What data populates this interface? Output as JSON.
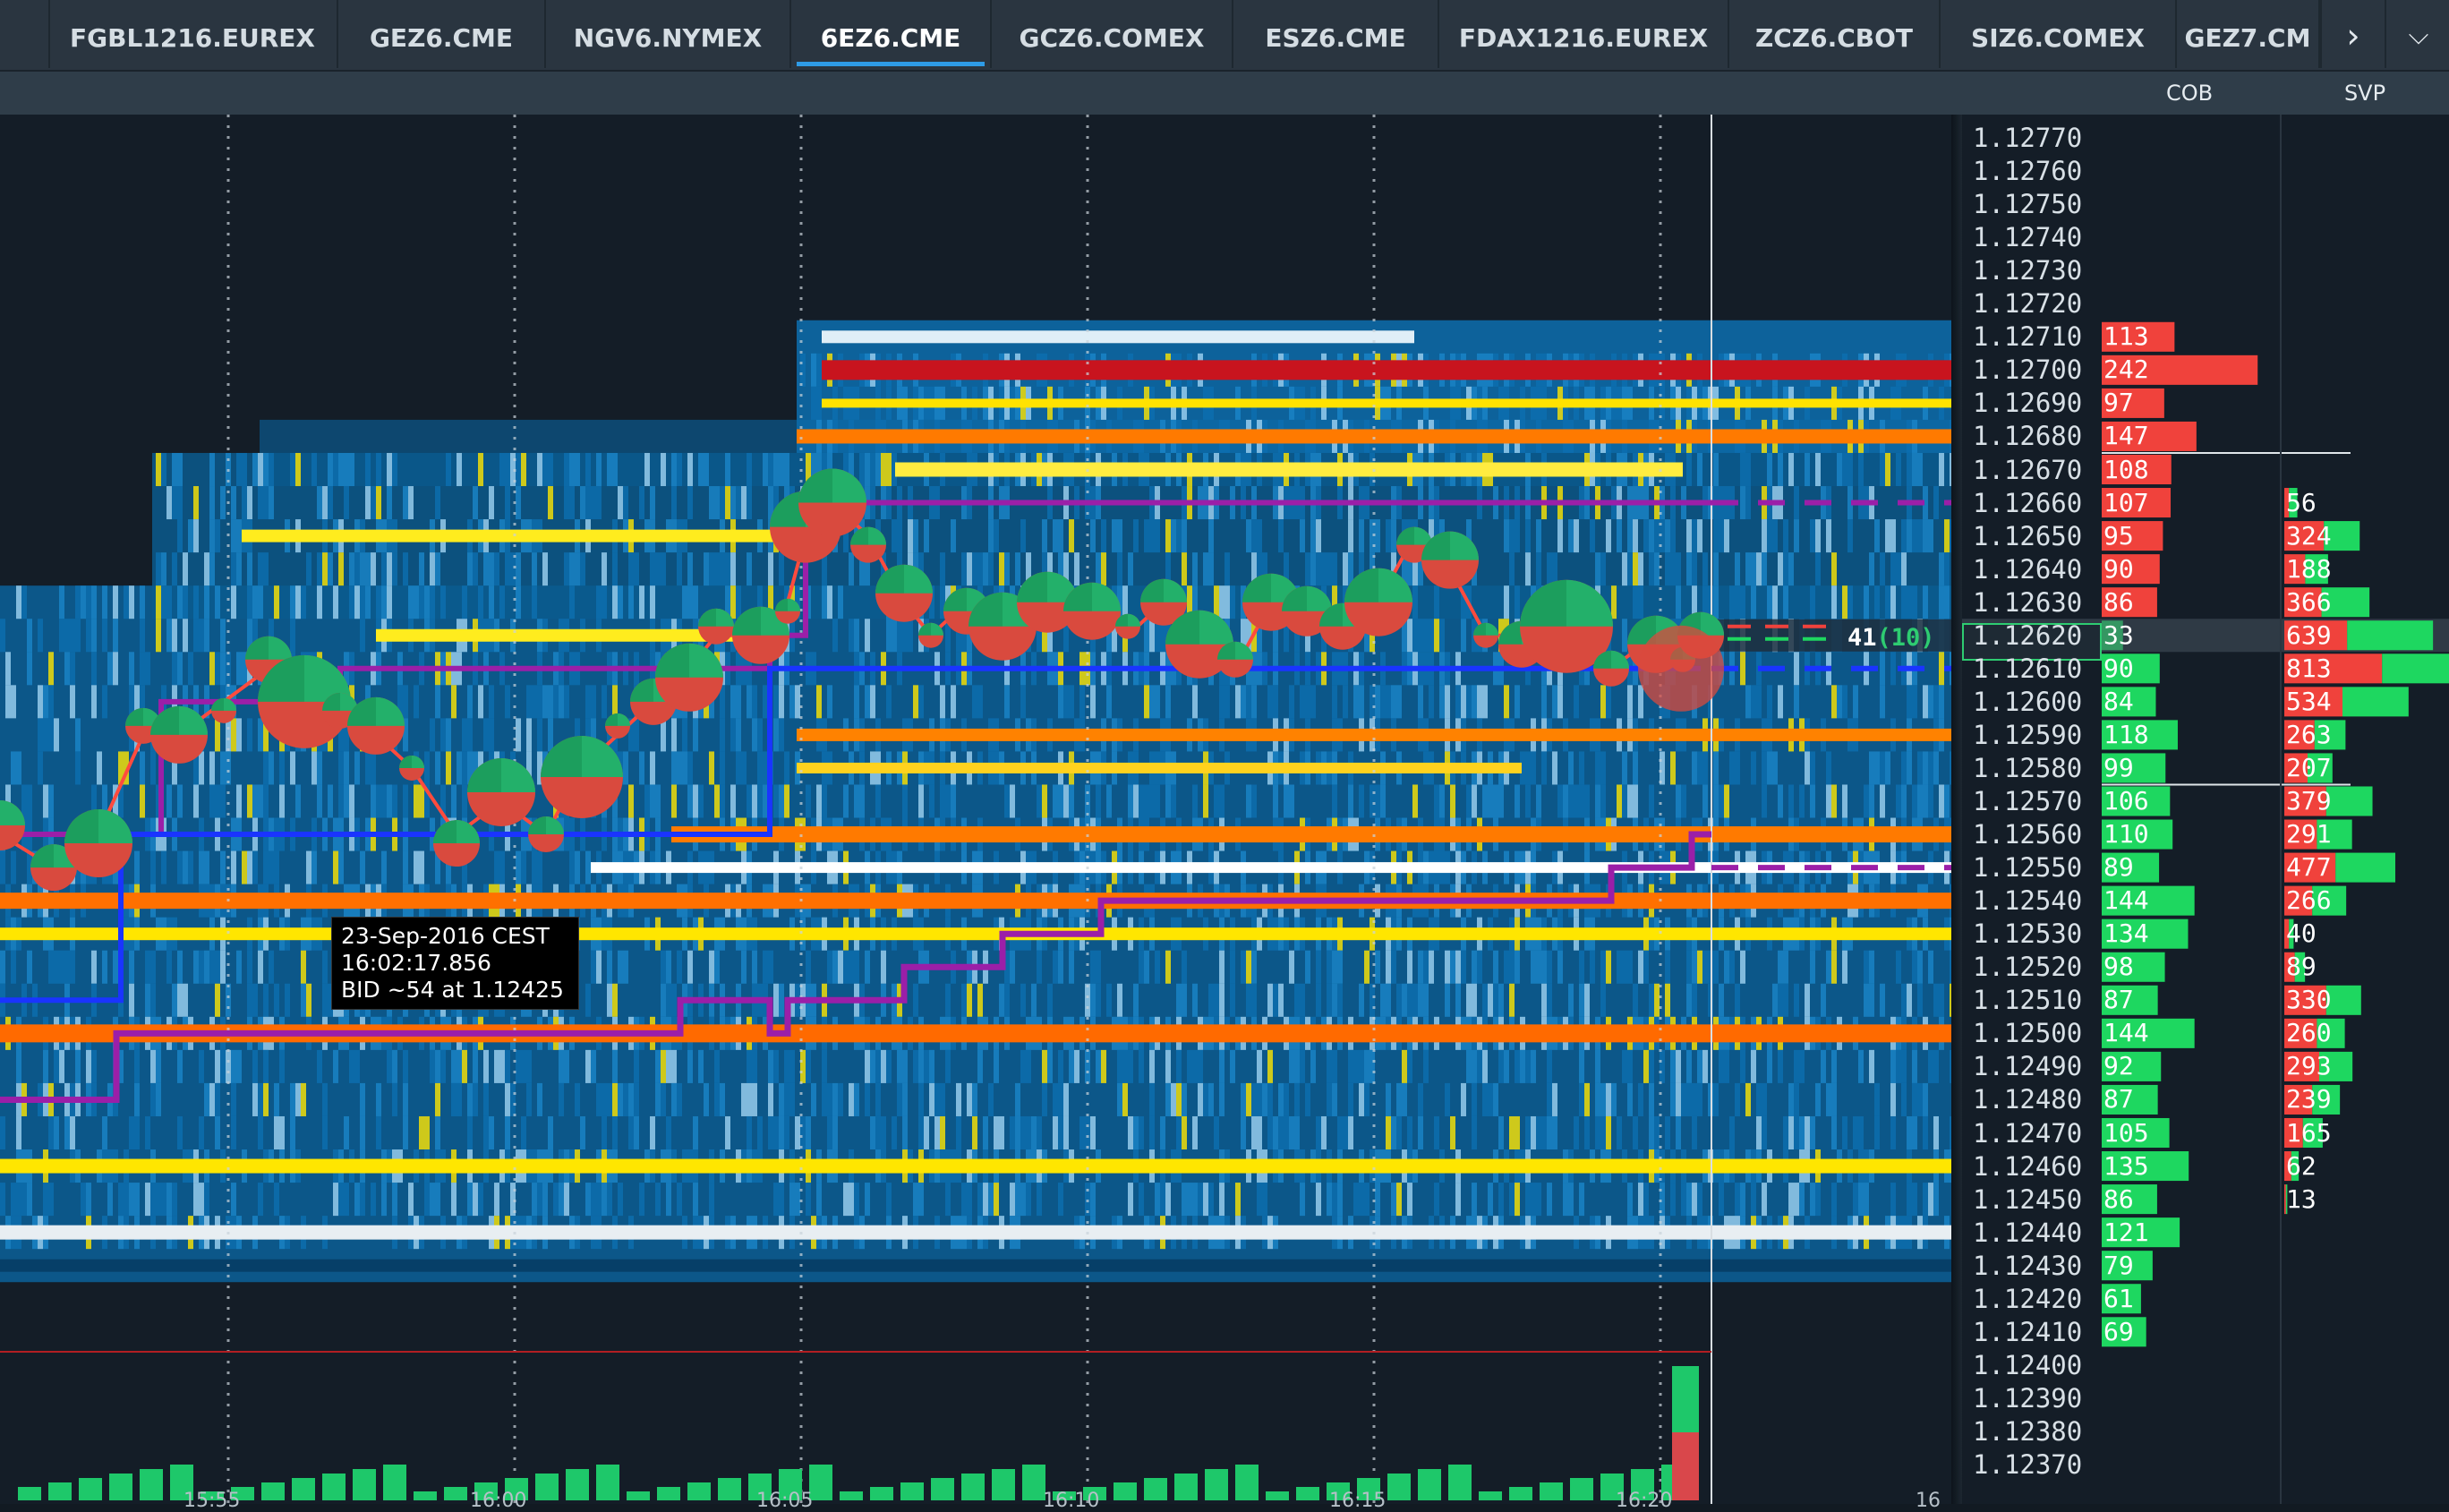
{
  "tabs": [
    {
      "label": "FGBL1216.EUREX",
      "active": false
    },
    {
      "label": "GEZ6.CME",
      "active": false
    },
    {
      "label": "NGV6.NYMEX",
      "active": false
    },
    {
      "label": "6EZ6.CME",
      "active": true
    },
    {
      "label": "GCZ6.COMEX",
      "active": false
    },
    {
      "label": "ESZ6.CME",
      "active": false
    },
    {
      "label": "FDAX1216.EUREX",
      "active": false
    },
    {
      "label": "ZCZ6.CBOT",
      "active": false
    },
    {
      "label": "SIZ6.COMEX",
      "active": false
    },
    {
      "label": "GEZ7.CM",
      "active": false
    }
  ],
  "tab_next_icon": "chevron-right-icon",
  "tab_menu_icon": "chevron-down-icon",
  "columns": {
    "cob": "COB",
    "svp": "SVP"
  },
  "tooltip": {
    "line1": "23-Sep-2016 CEST",
    "line2": "16:02:17.856",
    "line3": "BID ~54 at 1.12425"
  },
  "current": {
    "size": "41",
    "count": "(10)"
  },
  "price_levels": [
    "1.12770",
    "1.12760",
    "1.12750",
    "1.12740",
    "1.12730",
    "1.12720",
    "1.12710",
    "1.12700",
    "1.12690",
    "1.12680",
    "1.12670",
    "1.12660",
    "1.12650",
    "1.12640",
    "1.12630",
    "1.12620",
    "1.12610",
    "1.12600",
    "1.12590",
    "1.12580",
    "1.12570",
    "1.12560",
    "1.12550",
    "1.12540",
    "1.12530",
    "1.12520",
    "1.12510",
    "1.12500",
    "1.12490",
    "1.12480",
    "1.12470",
    "1.12460",
    "1.12450",
    "1.12440",
    "1.12430",
    "1.12420",
    "1.12410",
    "1.12400",
    "1.12390",
    "1.12380",
    "1.12370"
  ],
  "cob": {
    "asks": [
      {
        "price": "1.12710",
        "size": "113",
        "value": 113
      },
      {
        "price": "1.12700",
        "size": "242",
        "value": 242
      },
      {
        "price": "1.12690",
        "size": "97",
        "value": 97
      },
      {
        "price": "1.12680",
        "size": "147",
        "value": 147
      },
      {
        "price": "1.12670",
        "size": "108",
        "value": 108
      },
      {
        "price": "1.12660",
        "size": "107",
        "value": 107
      },
      {
        "price": "1.12650",
        "size": "95",
        "value": 95
      },
      {
        "price": "1.12640",
        "size": "90",
        "value": 90
      },
      {
        "price": "1.12630",
        "size": "86",
        "value": 86
      }
    ],
    "bids": [
      {
        "price": "1.12620",
        "size": "33",
        "value": 33
      },
      {
        "price": "1.12610",
        "size": "90",
        "value": 90
      },
      {
        "price": "1.12600",
        "size": "84",
        "value": 84
      },
      {
        "price": "1.12590",
        "size": "118",
        "value": 118
      },
      {
        "price": "1.12580",
        "size": "99",
        "value": 99
      },
      {
        "price": "1.12570",
        "size": "106",
        "value": 106
      },
      {
        "price": "1.12560",
        "size": "110",
        "value": 110
      },
      {
        "price": "1.12550",
        "size": "89",
        "value": 89
      },
      {
        "price": "1.12540",
        "size": "144",
        "value": 144
      },
      {
        "price": "1.12530",
        "size": "134",
        "value": 134
      },
      {
        "price": "1.12520",
        "size": "98",
        "value": 98
      },
      {
        "price": "1.12510",
        "size": "87",
        "value": 87
      },
      {
        "price": "1.12500",
        "size": "144",
        "value": 144
      },
      {
        "price": "1.12490",
        "size": "92",
        "value": 92
      },
      {
        "price": "1.12480",
        "size": "87",
        "value": 87
      },
      {
        "price": "1.12470",
        "size": "105",
        "value": 105
      },
      {
        "price": "1.12460",
        "size": "135",
        "value": 135
      },
      {
        "price": "1.12450",
        "size": "86",
        "value": 86
      },
      {
        "price": "1.12440",
        "size": "121",
        "value": 121
      },
      {
        "price": "1.12430",
        "size": "79",
        "value": 79
      },
      {
        "price": "1.12420",
        "size": "61",
        "value": 61
      },
      {
        "price": "1.12410",
        "size": "69",
        "value": 69
      }
    ]
  },
  "svp": [
    {
      "price": "1.12660",
      "size": "56",
      "sell": 20,
      "buy": 36
    },
    {
      "price": "1.12650",
      "size": "324",
      "sell": 170,
      "buy": 154
    },
    {
      "price": "1.12640",
      "size": "188",
      "sell": 90,
      "buy": 98
    },
    {
      "price": "1.12630",
      "size": "366",
      "sell": 160,
      "buy": 206
    },
    {
      "price": "1.12620",
      "size": "639",
      "sell": 270,
      "buy": 369
    },
    {
      "price": "1.12610",
      "size": "813",
      "sell": 420,
      "buy": 393
    },
    {
      "price": "1.12600",
      "size": "534",
      "sell": 250,
      "buy": 284
    },
    {
      "price": "1.12590",
      "size": "263",
      "sell": 130,
      "buy": 133
    },
    {
      "price": "1.12580",
      "size": "207",
      "sell": 100,
      "buy": 107
    },
    {
      "price": "1.12570",
      "size": "379",
      "sell": 180,
      "buy": 199
    },
    {
      "price": "1.12560",
      "size": "291",
      "sell": 140,
      "buy": 151
    },
    {
      "price": "1.12550",
      "size": "477",
      "sell": 220,
      "buy": 257
    },
    {
      "price": "1.12540",
      "size": "266",
      "sell": 120,
      "buy": 146
    },
    {
      "price": "1.12530",
      "size": "40",
      "sell": 20,
      "buy": 20
    },
    {
      "price": "1.12520",
      "size": "89",
      "sell": 45,
      "buy": 44
    },
    {
      "price": "1.12510",
      "size": "330",
      "sell": 180,
      "buy": 150
    },
    {
      "price": "1.12500",
      "size": "260",
      "sell": 140,
      "buy": 120
    },
    {
      "price": "1.12490",
      "size": "293",
      "sell": 150,
      "buy": 143
    },
    {
      "price": "1.12480",
      "size": "239",
      "sell": 120,
      "buy": 119
    },
    {
      "price": "1.12470",
      "size": "165",
      "sell": 80,
      "buy": 85
    },
    {
      "price": "1.12460",
      "size": "62",
      "sell": 30,
      "buy": 32
    },
    {
      "price": "1.12450",
      "size": "13",
      "sell": 7,
      "buy": 6
    }
  ],
  "time_labels": [
    "15:55",
    "16:00",
    "16:05",
    "16:10",
    "16:15",
    "16:20",
    "16"
  ],
  "colors": {
    "ask": "#f0423c",
    "bid": "#1ed760",
    "vwap": "#9b1fa8",
    "bid_line": "#1a34ff",
    "heat_low": "#0a6fb0",
    "heat_high": "#ffe600",
    "heat_max": "#ff6a00"
  }
}
